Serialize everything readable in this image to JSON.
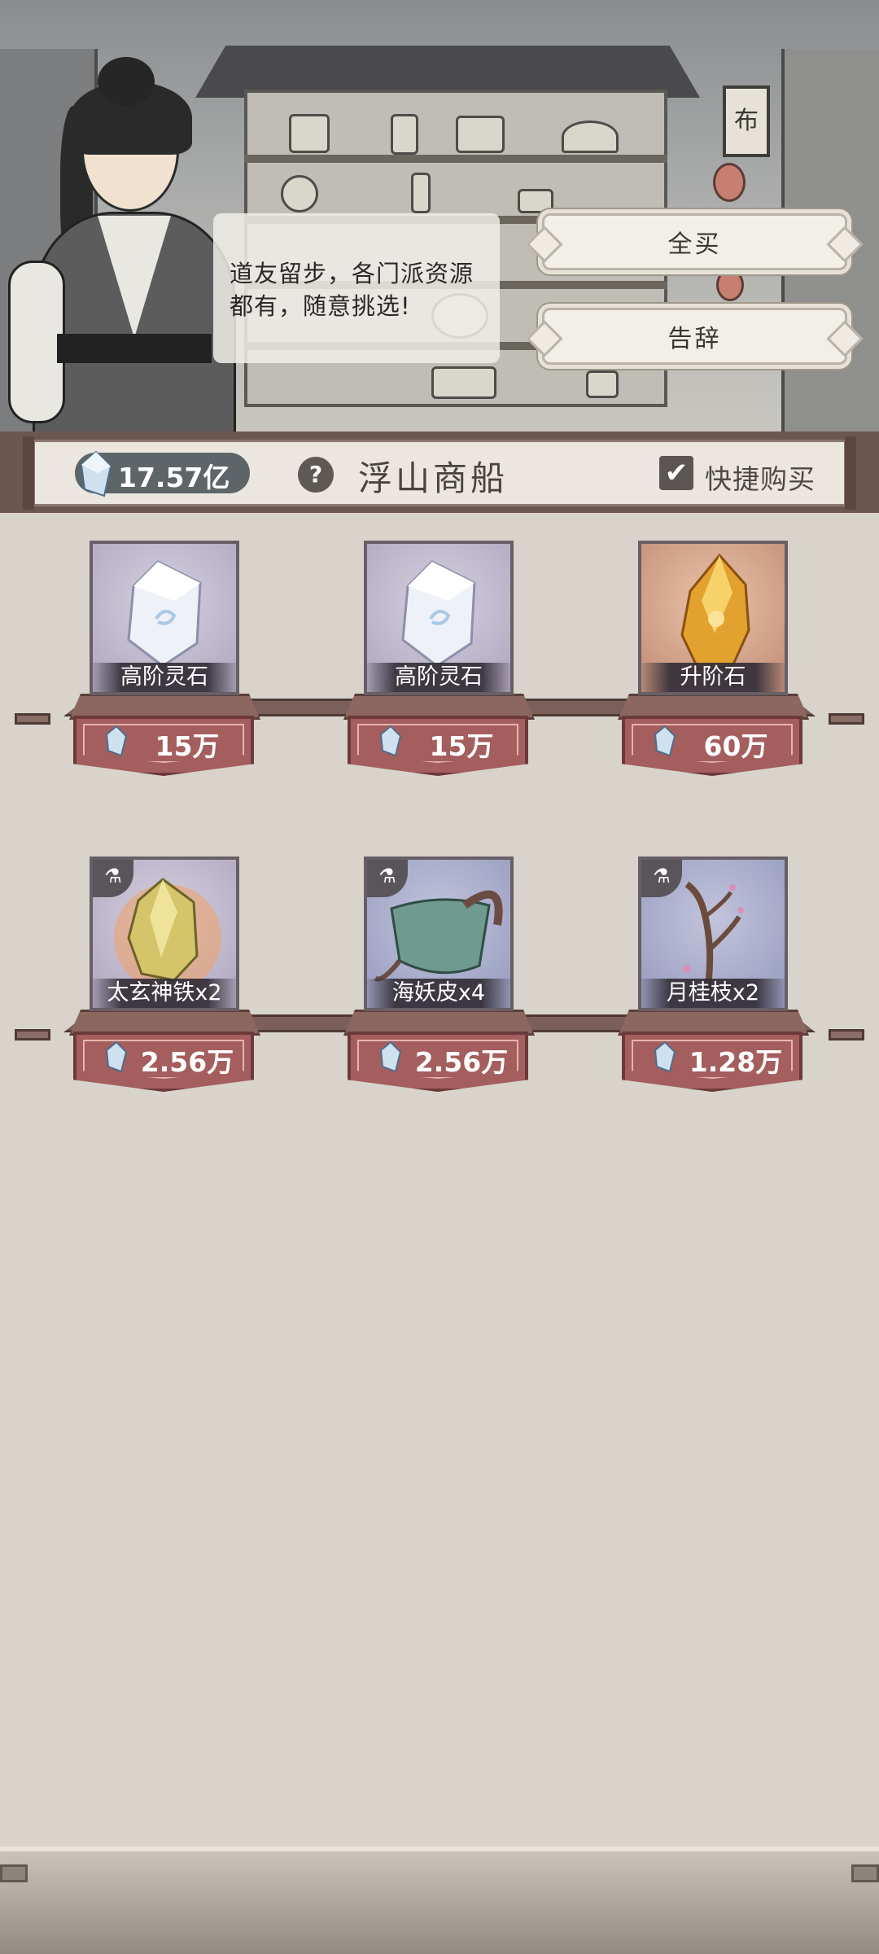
{
  "scene": {
    "shop_sign": "布",
    "dialog_text_line1": "道友留步，各门派资源",
    "dialog_text_line2": "都有，随意挑选!"
  },
  "buttons": {
    "buy_all": "全买",
    "farewell": "告辞"
  },
  "header": {
    "currency_value": "17.57亿",
    "help_label": "?",
    "title": "浮山商船",
    "quick_buy_label": "快捷购买",
    "quick_buy_checked": true,
    "check_mark": "✔"
  },
  "items": [
    {
      "name": "高阶灵石",
      "price": "15万",
      "bg": "purple",
      "icon": "spirit-stone-icon",
      "badge": false
    },
    {
      "name": "高阶灵石",
      "price": "15万",
      "bg": "purple",
      "icon": "spirit-stone-icon",
      "badge": false
    },
    {
      "name": "升阶石",
      "price": "60万",
      "bg": "orange",
      "icon": "ascension-stone-icon",
      "badge": false
    },
    {
      "name": "太玄神铁x2",
      "price": "2.56万",
      "bg": "purple",
      "icon": "divine-iron-icon",
      "badge": true
    },
    {
      "name": "海妖皮x4",
      "price": "2.56万",
      "bg": "blue",
      "icon": "sea-demon-skin-icon",
      "badge": true
    },
    {
      "name": "月桂枝x2",
      "price": "1.28万",
      "bg": "blue",
      "icon": "laurel-branch-icon",
      "badge": true
    }
  ],
  "badge_glyph": "⚗",
  "colors": {
    "price_tag": "#a45e5d",
    "card_purple": "#b6adc4",
    "card_orange": "#c99680",
    "card_blue": "#9ea2c3",
    "currency_pill": "#5e6569"
  }
}
